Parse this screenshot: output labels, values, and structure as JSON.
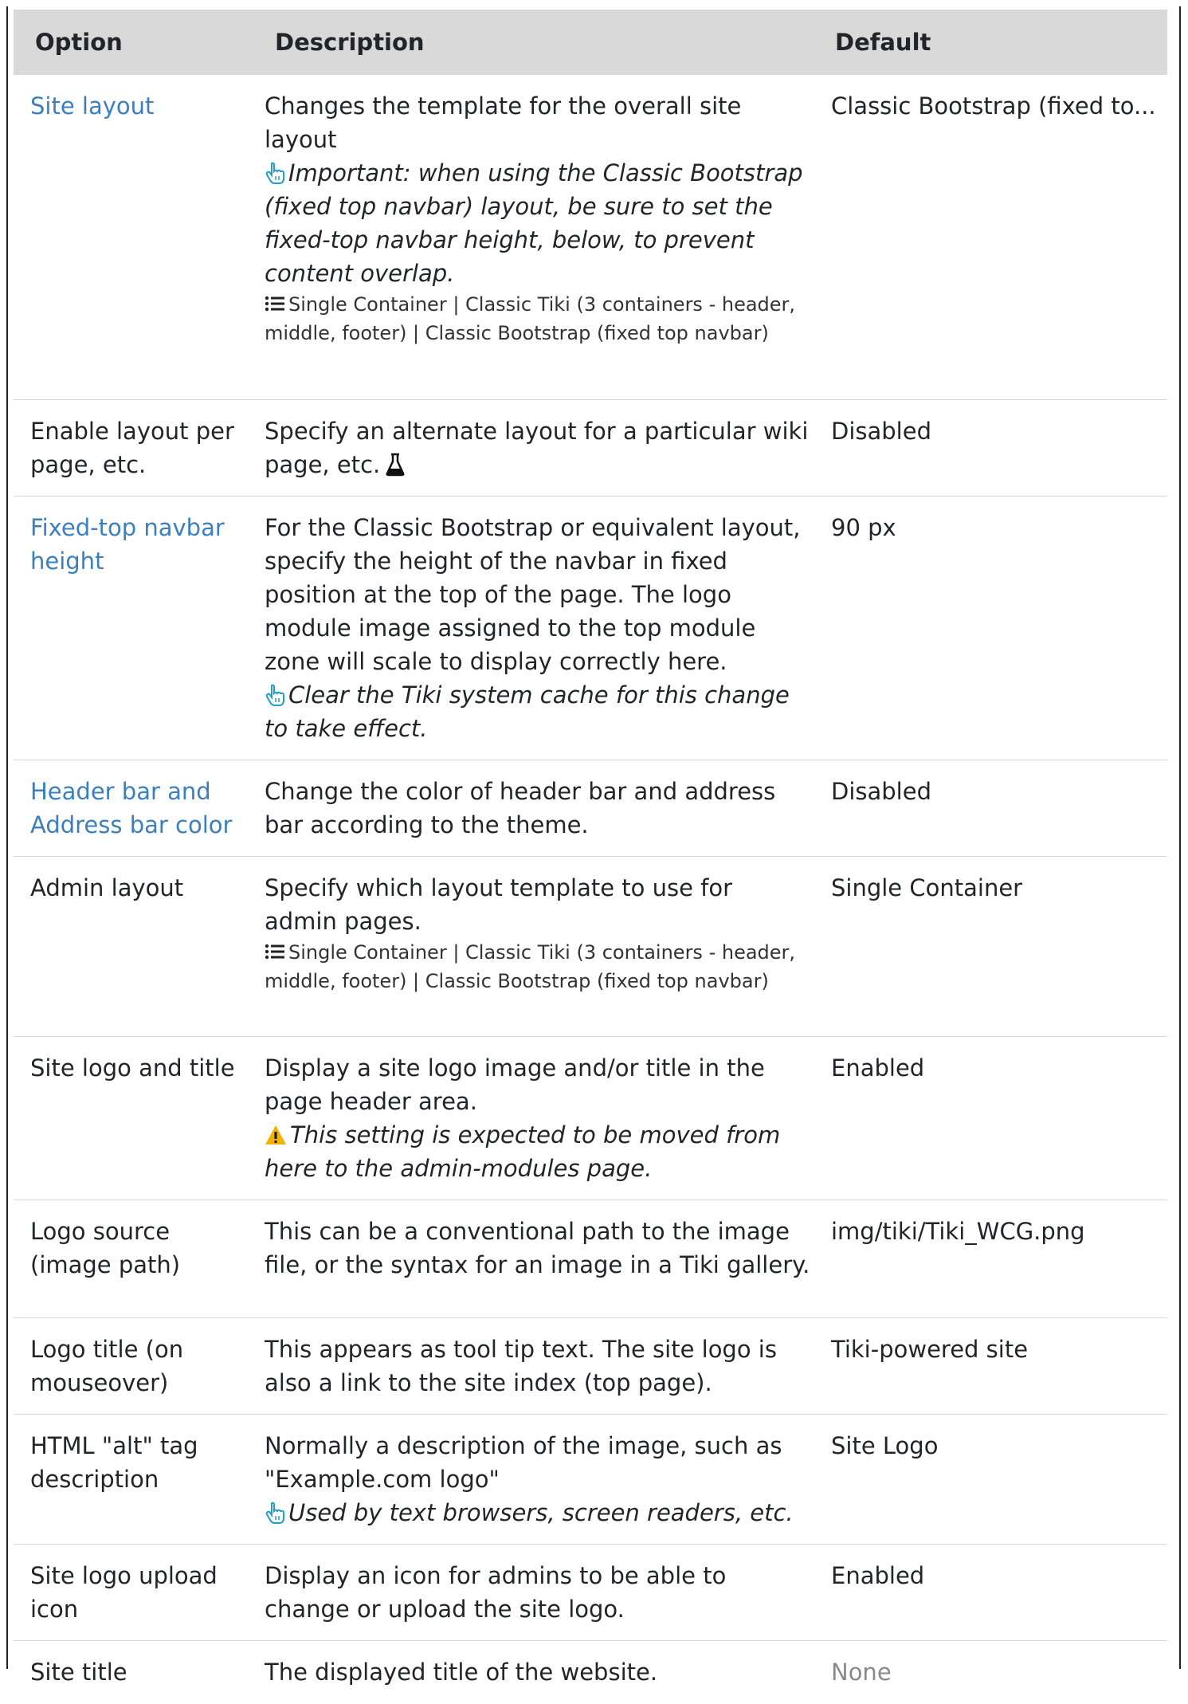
{
  "header": {
    "option": "Option",
    "description": "Description",
    "default": "Default"
  },
  "rows": [
    {
      "option": "Site layout",
      "description": "Changes the template for the overall site layout",
      "note": "Important: when using the Classic Bootstrap (fixed top navbar) layout, be sure to set the fixed-top navbar height, below, to prevent content overlap.",
      "options": "Single Container | Classic Tiki (3 containers - header, middle, footer) | Classic Bootstrap (fixed top navbar)",
      "default": "Classic Bootstrap (fixed to..."
    },
    {
      "option": "Enable layout per page, etc.",
      "description": "Specify an alternate layout for a particular wiki page, etc.",
      "default": "Disabled"
    },
    {
      "option": "Fixed-top navbar height",
      "description": "For the Classic Bootstrap or equivalent layout, specify the height of the navbar in fixed position at the top of the page. The logo module image assigned to the top module zone will scale to display correctly here.",
      "note": "Clear the Tiki system cache for this change to take effect.",
      "default": "90 px"
    },
    {
      "option": "Header bar and Address bar color",
      "description": "Change the color of header bar and address bar according to the theme.",
      "default": "Disabled"
    },
    {
      "option": "Admin layout",
      "description": "Specify which layout template to use for admin pages.",
      "options": "Single Container | Classic Tiki (3 containers - header, middle, footer) | Classic Bootstrap (fixed top navbar)",
      "default": "Single Container"
    },
    {
      "option": "Site logo and title",
      "description": "Display a site logo image and/or title in the page header area.",
      "warning": "This setting is expected to be moved from here to the admin-modules page.",
      "default": "Enabled"
    },
    {
      "option": "Logo source (image path)",
      "description": "This can be a conventional path to the image file, or the syntax for an image in a Tiki gallery.",
      "default": "img/tiki/Tiki_WCG.png"
    },
    {
      "option": "Logo title (on mouseover)",
      "description": "This appears as tool tip text. The site logo is also a link to the site index (top page).",
      "default": "Tiki-powered site"
    },
    {
      "option": "HTML \"alt\" tag description",
      "description": "Normally a description of the image, such as \"Example.com logo\"",
      "note": "Used by text browsers, screen readers, etc.",
      "default": "Site Logo"
    },
    {
      "option": "Site logo upload icon",
      "description": "Display an icon for admins to be able to change or upload the site logo.",
      "default": "Enabled"
    },
    {
      "option": "Site title",
      "description": "The displayed title of the website.",
      "default": "None"
    }
  ],
  "colors": {
    "link": "#3a80c0",
    "header_bg": "#d9d9d9",
    "hand_icon": "#1da1c8",
    "warning_icon": "#f0b400",
    "muted": "#8a8a8a"
  },
  "icons": {
    "note": "hand-pointer-icon",
    "options": "list-icon",
    "experimental": "flask-icon",
    "warning": "warning-icon"
  }
}
